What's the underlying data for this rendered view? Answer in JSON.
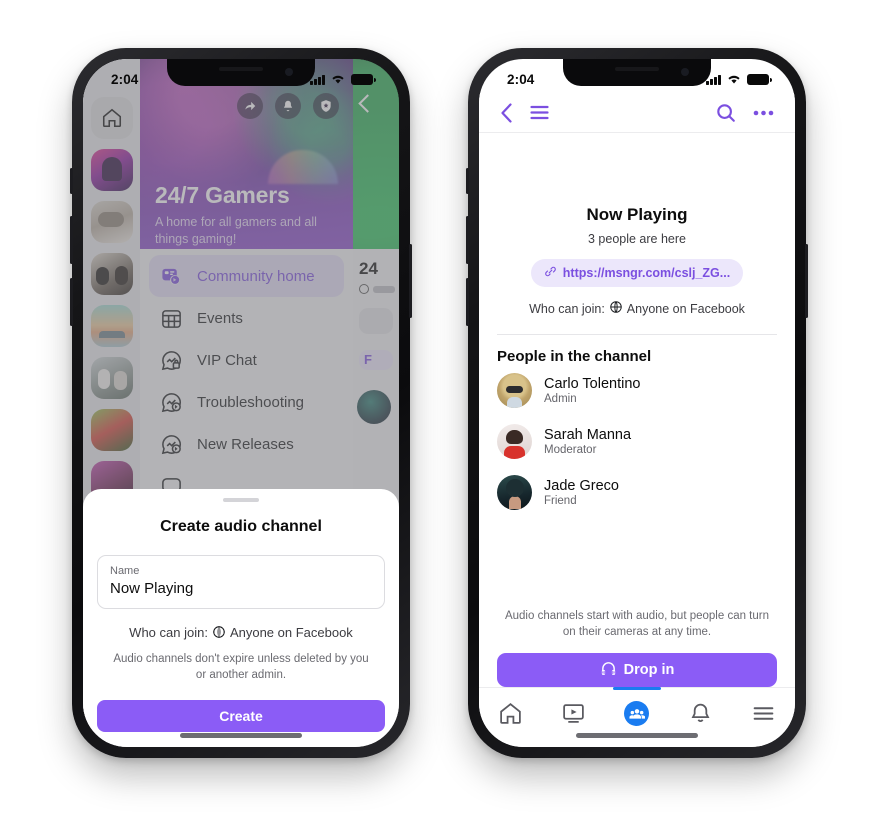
{
  "left_phone": {
    "status_bar": {
      "time": "2:04",
      "signal_icon": "cellular-bars-icon",
      "wifi_icon": "wifi-icon",
      "battery_icon": "battery-icon"
    },
    "hero": {
      "title": "24/7 Gamers",
      "subtitle": "A home for all gamers and all things gaming!",
      "actions": [
        {
          "name": "share-icon",
          "label": "Share"
        },
        {
          "name": "bell-icon",
          "label": "Notifications"
        },
        {
          "name": "shield-star-icon",
          "label": "Admin"
        }
      ]
    },
    "rail": {
      "home_label": "Home",
      "thumbnails": [
        "community-thumb-1",
        "community-thumb-2",
        "community-thumb-3",
        "community-thumb-4",
        "community-thumb-5",
        "community-thumb-6",
        "community-thumb-7"
      ]
    },
    "menu": {
      "items": [
        {
          "label": "Community home",
          "icon": "community-home-icon",
          "active": true
        },
        {
          "label": "Events",
          "icon": "calendar-grid-icon",
          "active": false
        },
        {
          "label": "VIP Chat",
          "icon": "chat-lock-icon",
          "active": false
        },
        {
          "label": "Troubleshooting",
          "icon": "chat-audio-icon",
          "active": false
        },
        {
          "label": "New Releases",
          "icon": "chat-audio-icon",
          "active": false
        }
      ]
    },
    "background_right": {
      "title": "24",
      "pill_text": "F",
      "back_icon": "chevron-left-icon"
    },
    "sheet": {
      "title": "Create audio channel",
      "field_label": "Name",
      "field_value": "Now Playing",
      "field_placeholder": "Name",
      "who_can_join_label": "Who can join:",
      "who_can_join_value": "Anyone on Facebook",
      "who_can_join_icon": "globe-icon",
      "note": "Audio channels don't expire unless deleted by you or another admin.",
      "create_label": "Create"
    }
  },
  "right_phone": {
    "status_bar": {
      "time": "2:04",
      "signal_icon": "cellular-bars-icon",
      "wifi_icon": "wifi-icon",
      "battery_icon": "battery-icon"
    },
    "header": {
      "back_icon": "chevron-left-icon",
      "menu_icon": "hamburger-menu-icon",
      "search_icon": "search-icon",
      "more_icon": "more-horizontal-icon"
    },
    "channel": {
      "title": "Now Playing",
      "people_count_text": "3 people are here",
      "link": "https://msngr.com/cslj_ZG...",
      "link_icon": "link-icon",
      "who_can_join_label": "Who can join:",
      "who_can_join_value": "Anyone on Facebook",
      "who_can_join_icon": "globe-icon"
    },
    "people_section": {
      "title": "People in the channel",
      "people": [
        {
          "name": "Carlo Tolentino",
          "role": "Admin",
          "avatar": "avatar-carlo"
        },
        {
          "name": "Sarah Manna",
          "role": "Moderator",
          "avatar": "avatar-sarah"
        },
        {
          "name": "Jade Greco",
          "role": "Friend",
          "avatar": "avatar-jade"
        }
      ]
    },
    "footer": {
      "note": "Audio channels start with audio, but people can turn on their cameras at any time.",
      "drop_in_label": "Drop in",
      "drop_in_icon": "headphones-icon"
    },
    "tab_bar": {
      "tabs": [
        {
          "label": "Home",
          "icon": "home-icon",
          "active": false
        },
        {
          "label": "Watch",
          "icon": "video-icon",
          "active": false
        },
        {
          "label": "Groups",
          "icon": "people-group-icon",
          "active": true
        },
        {
          "label": "Notifications",
          "icon": "bell-icon",
          "active": false
        },
        {
          "label": "Menu",
          "icon": "hamburger-menu-icon",
          "active": false
        }
      ]
    }
  },
  "colors": {
    "brand_purple": "#8b5cf6",
    "link_purple": "#7b4fe0",
    "pill_bg": "#ece7fb",
    "facebook_blue": "#1a7cf0",
    "text_primary": "#0d0d0d",
    "text_secondary": "#6a6a70"
  }
}
